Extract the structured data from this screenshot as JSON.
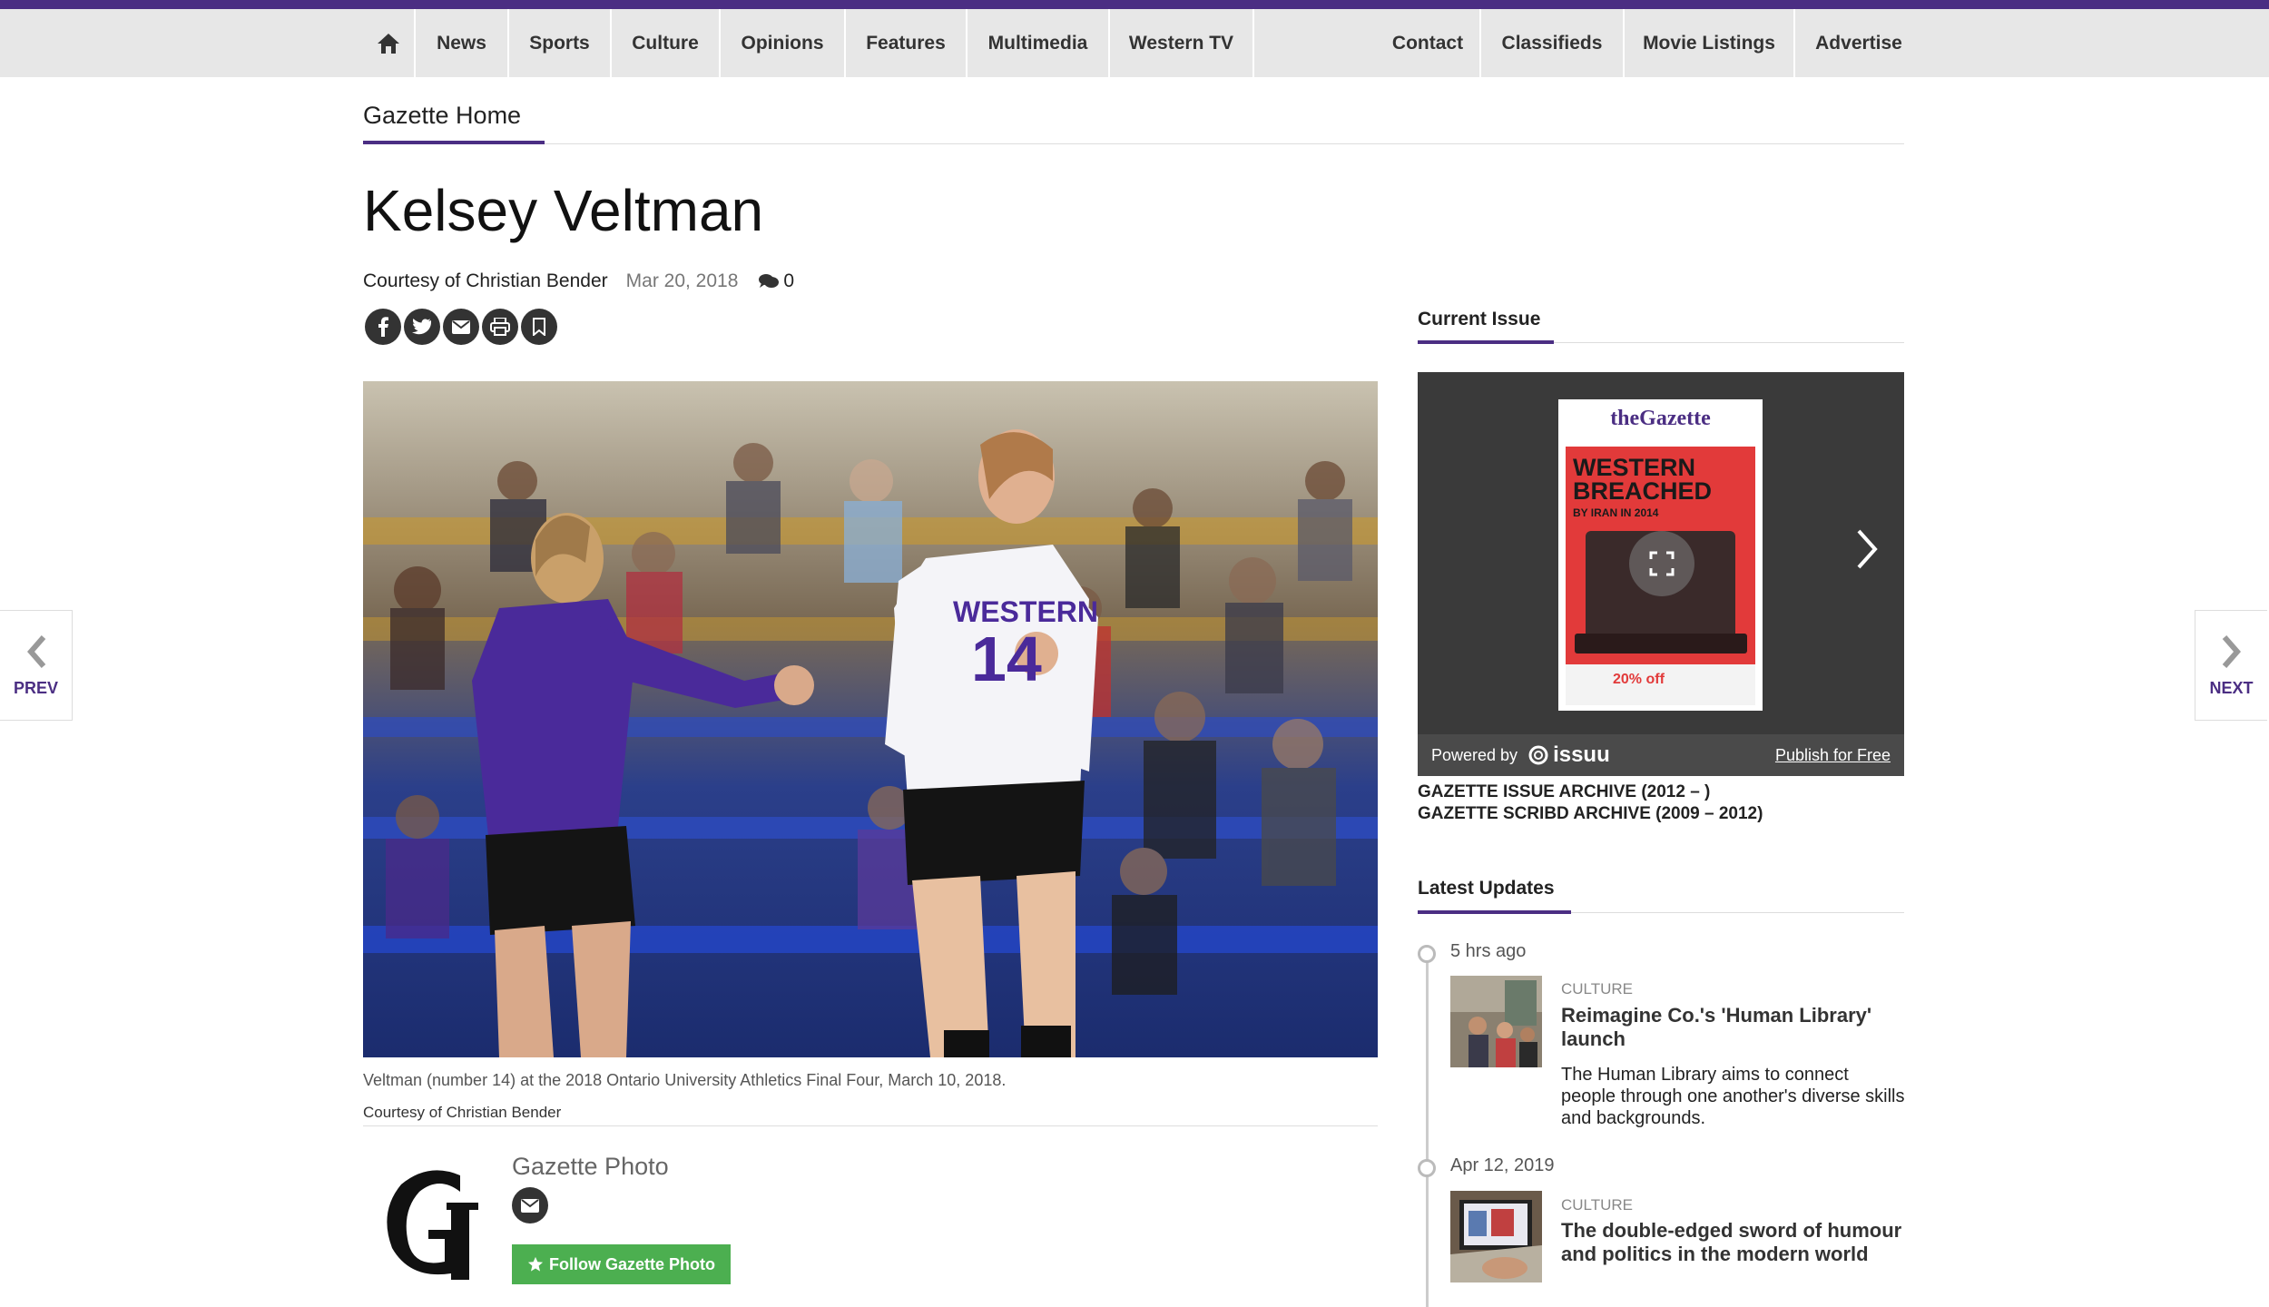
{
  "nav": {
    "home_icon": "home-icon",
    "items": [
      "News",
      "Sports",
      "Culture",
      "Opinions",
      "Features",
      "Multimedia",
      "Western TV"
    ],
    "right_items": [
      "Contact",
      "Classifieds",
      "Movie Listings",
      "Advertise"
    ]
  },
  "section": {
    "tab": "Gazette Home"
  },
  "article": {
    "title": "Kelsey Veltman",
    "byline": "Courtesy of Christian Bender",
    "date": "Mar 20, 2018",
    "comment_count": "0",
    "share_icons": [
      "facebook-icon",
      "twitter-icon",
      "email-icon",
      "print-icon",
      "bookmark-icon"
    ],
    "caption": "Veltman (number 14) at the 2018 Ontario University Athletics Final Four, March 10, 2018.",
    "caption_credit": "Courtesy of Christian Bender",
    "jersey_text": "WESTERN",
    "jersey_number": "14"
  },
  "author": {
    "name": "Gazette Photo",
    "follow_label": "Follow Gazette Photo"
  },
  "sidebar": {
    "current_issue_heading": "Current Issue",
    "issuu": {
      "powered_by": "Powered by",
      "brand": "issuu",
      "publish_label": "Publish for Free",
      "cover_masthead": "theGazette",
      "cover_headline_1": "WESTERN",
      "cover_headline_2": "BREACHED",
      "cover_sub": "BY IRAN IN 2014",
      "cover_promo": "20% off"
    },
    "archive_links": [
      "GAZETTE ISSUE ARCHIVE (2012 – )",
      "GAZETTE SCRIBD ARCHIVE (2009 – 2012)"
    ],
    "latest_heading": "Latest Updates",
    "updates": [
      {
        "time": "5 hrs ago",
        "category": "CULTURE",
        "title": "Reimagine Co.'s 'Human Library' launch",
        "desc": "The Human Library aims to connect people through one another's diverse skills and backgrounds."
      },
      {
        "time": "Apr 12, 2019",
        "category": "CULTURE",
        "title": "The double-edged sword of humour and politics in the modern world",
        "desc": ""
      }
    ]
  },
  "pager": {
    "prev": "PREV",
    "next": "NEXT"
  },
  "colors": {
    "brand_purple": "#4b2e83",
    "follow_green": "#4caf50",
    "nav_bg": "#e7e7e7"
  }
}
